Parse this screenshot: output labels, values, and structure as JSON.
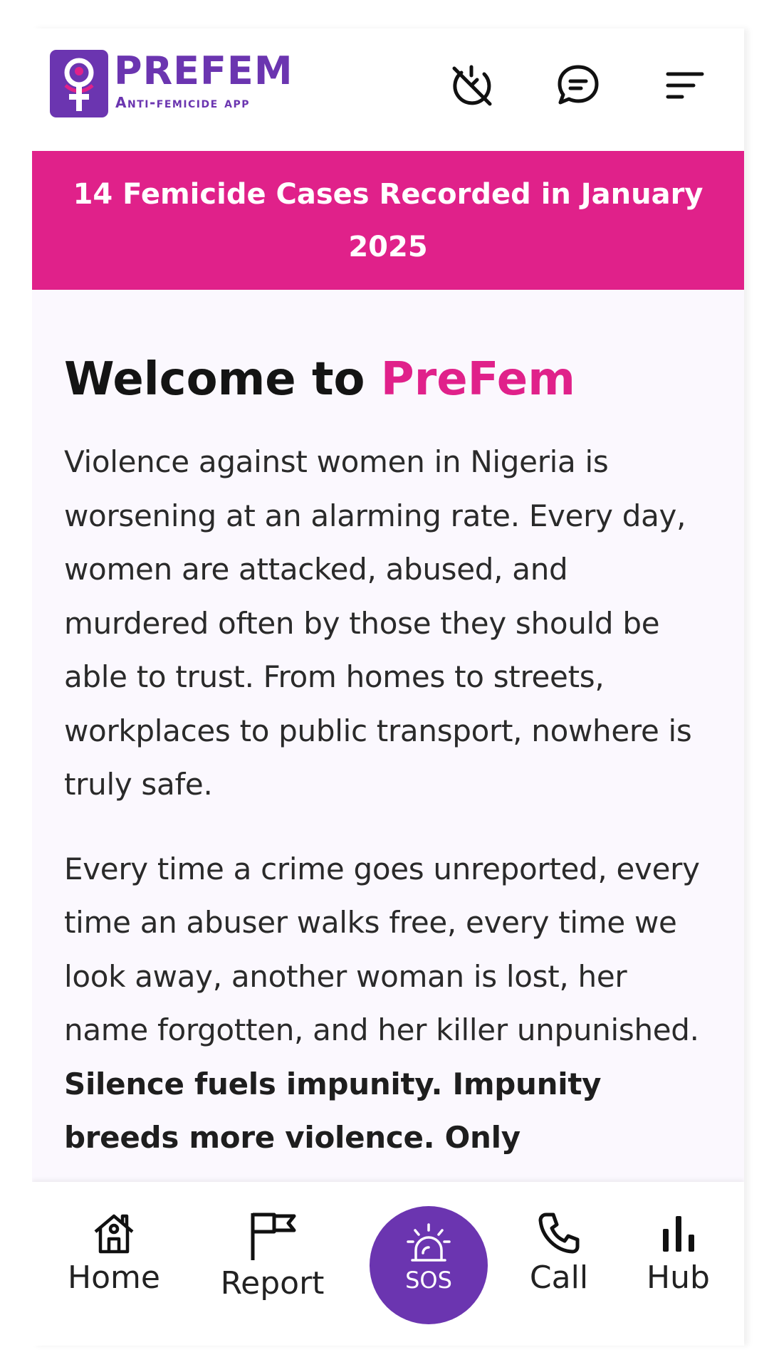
{
  "header": {
    "logo_title": "PREFEM",
    "logo_subtitle": "Anti-femicide app",
    "icons": [
      "timer-off-icon",
      "chat-icon",
      "menu-icon"
    ]
  },
  "banner": {
    "text": "14 Femicide Cases Recorded in January 2025"
  },
  "content": {
    "welcome_prefix": "Welcome to ",
    "welcome_brand": "PreFem",
    "paragraph1": "Violence against women in Nigeria is worsening at an alarming rate. Every day, women are attacked, abused, and murdered often by those they should be able to trust. From homes to streets, workplaces to public transport, nowhere is truly safe.",
    "paragraph2_plain": "Every time a crime goes unreported, every time an abuser walks free, every time we look away, another woman is lost, her name forgotten, and her killer unpunished. ",
    "paragraph2_bold": "Silence fuels impunity. Impunity breeds more violence. Only"
  },
  "bottom_nav": {
    "home": "Home",
    "report": "Report",
    "sos": "SOS",
    "call": "Call",
    "hub": "Hub"
  },
  "colors": {
    "brand_purple": "#6b35b0",
    "brand_pink": "#e0218a"
  }
}
